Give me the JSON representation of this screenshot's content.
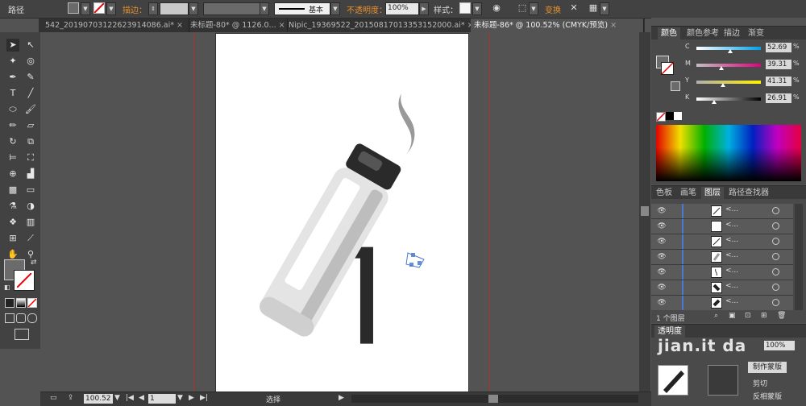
{
  "control_bar": {
    "label_path": "路径",
    "stroke_label": "描边：",
    "stroke_style": "基本",
    "opacity_label": "不透明度：",
    "opacity_value": "100%",
    "style_label": "样式：",
    "transform_label": "变换"
  },
  "tabs": [
    {
      "label": "542_20190703122623914086.ai*",
      "close": "×"
    },
    {
      "label": "未标题-80* @ 1126.0...",
      "close": "×"
    },
    {
      "label": "Nipic_19369522_20150817013353152000.ai*",
      "close": "×"
    },
    {
      "label": "未标题-86* @ 100.52% (CMYK/预览)",
      "close": "×"
    }
  ],
  "statusbar": {
    "zoom": "100.52",
    "page": "1",
    "tool_status": "选择"
  },
  "color_panel": {
    "tabs": [
      "颜色",
      "颜色参考",
      "描边",
      "渐变"
    ],
    "sliders": [
      {
        "label": "C",
        "value": "52.69",
        "fraction": 0.5269,
        "from": "#ffffff",
        "to": "#00a0e9"
      },
      {
        "label": "M",
        "value": "39.31",
        "fraction": 0.3931,
        "from": "#c0c0c0",
        "to": "#e4007f"
      },
      {
        "label": "Y",
        "value": "41.31",
        "fraction": 0.4131,
        "from": "#b0b0b0",
        "to": "#fff100"
      },
      {
        "label": "K",
        "value": "26.91",
        "fraction": 0.2691,
        "from": "#ffffff",
        "to": "#000000"
      }
    ],
    "pct": "%"
  },
  "layers_panel": {
    "tabs": [
      "色板",
      "画笔",
      "图层",
      "路径查找器"
    ],
    "rows": [
      {
        "name": "<...",
        "thumb": "line"
      },
      {
        "name": "<...",
        "thumb": "blank"
      },
      {
        "name": "<...",
        "thumb": "line"
      },
      {
        "name": "<...",
        "thumb": "grey"
      },
      {
        "name": "<...",
        "thumb": "curve"
      },
      {
        "name": "<...",
        "thumb": "dark"
      },
      {
        "name": "<...",
        "thumb": "dark"
      },
      {
        "name": "<...",
        "thumb": "line"
      }
    ],
    "footer_count": "1 个图层"
  },
  "transparency_panel": {
    "title": "透明度",
    "opacity_value": "100%",
    "make_mask_button": "制作蒙版",
    "clip_label": "剪切",
    "invert_label": "反相蒙版",
    "watermark": "jian.it  da"
  },
  "colors": {
    "accent": "#4a7bd4",
    "guide": "#aa3333",
    "bottle_dark": "#2a2a2a",
    "bottle_light": "#e4e4e4"
  }
}
